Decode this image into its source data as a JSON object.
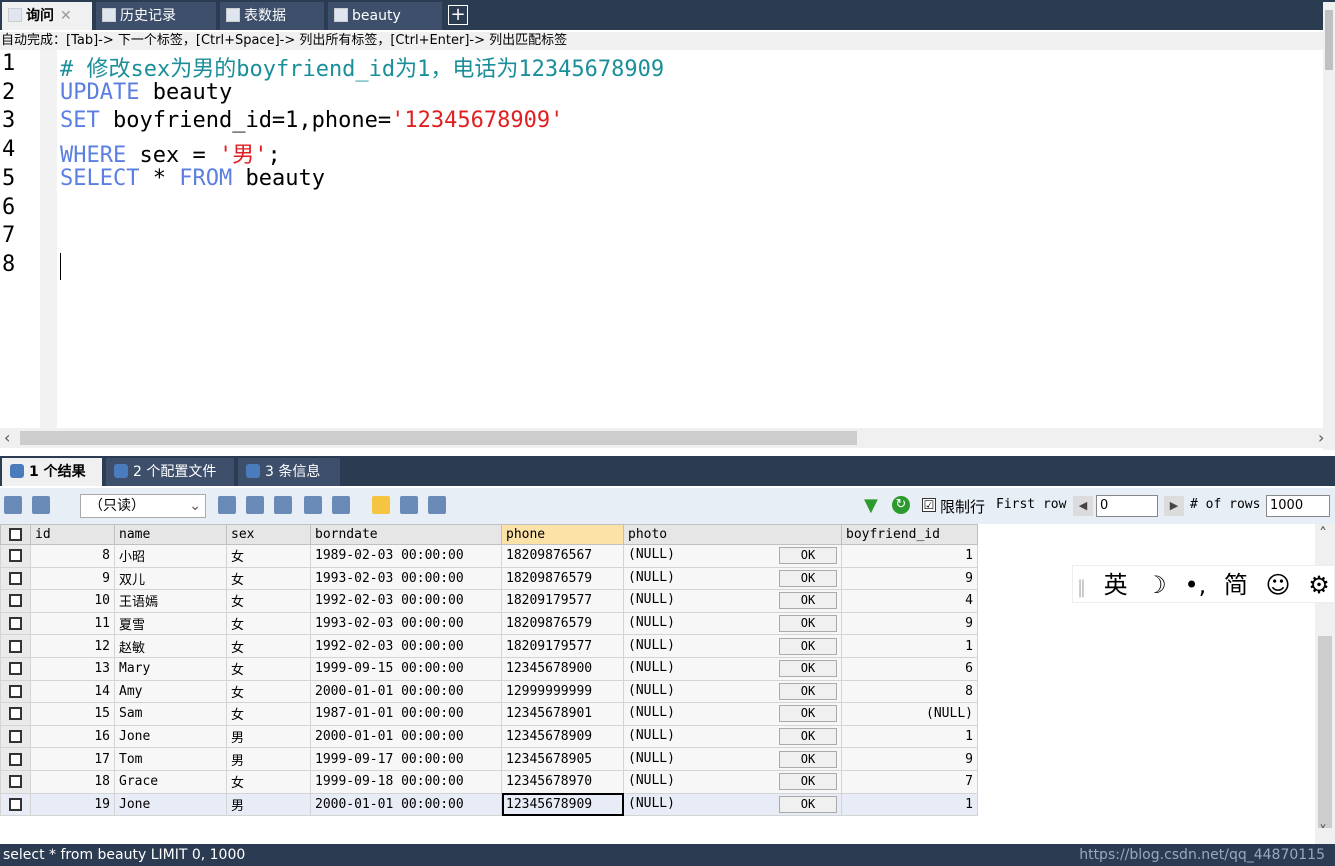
{
  "tabs": [
    {
      "label": "询问",
      "active": true,
      "icon": "query-icon",
      "closable": true
    },
    {
      "label": "历史记录",
      "active": false,
      "icon": "history-icon"
    },
    {
      "label": "表数据",
      "active": false,
      "icon": "table-data-icon"
    },
    {
      "label": "beauty",
      "active": false,
      "icon": "table-icon"
    }
  ],
  "tab_add_label": "+",
  "autocomplete_hint": "自动完成：[Tab]-> 下一个标签，[Ctrl+Space]-> 列出所有标签，[Ctrl+Enter]-> 列出匹配标签",
  "editor": {
    "line_numbers": [
      "1",
      "2",
      "3",
      "4",
      "5",
      "6",
      "7",
      "8"
    ],
    "lines": [
      [
        {
          "t": "# 修改sex为男的boyfriend_id为1，电话为12345678909",
          "c": "cm"
        }
      ],
      [
        {
          "t": "UPDATE",
          "c": "kw"
        },
        {
          "t": " beauty",
          "c": ""
        }
      ],
      [
        {
          "t": "SET",
          "c": "kw"
        },
        {
          "t": " boyfriend_id=1,phone=",
          "c": ""
        },
        {
          "t": "'12345678909'",
          "c": "str"
        }
      ],
      [
        {
          "t": "WHERE",
          "c": "kw"
        },
        {
          "t": " sex = ",
          "c": ""
        },
        {
          "t": "'男'",
          "c": "str"
        },
        {
          "t": ";",
          "c": ""
        }
      ],
      [
        {
          "t": "SELECT",
          "c": "kw"
        },
        {
          "t": " * ",
          "c": ""
        },
        {
          "t": "FROM",
          "c": "kw"
        },
        {
          "t": " beauty",
          "c": ""
        }
      ],
      [],
      [],
      []
    ]
  },
  "result_tabs": [
    {
      "label": "1 个结果",
      "active": true
    },
    {
      "label": "2 个配置文件",
      "active": false
    },
    {
      "label": "3 条信息",
      "active": false
    }
  ],
  "toolbar": {
    "readonly_label": "（只读）",
    "limit_label": "限制行",
    "limit_checked": "☑",
    "first_row_label": "First row",
    "first_row_value": "0",
    "rows_label": "# of rows",
    "rows_value": "1000"
  },
  "grid": {
    "columns": [
      "id",
      "name",
      "sex",
      "borndate",
      "phone",
      "photo",
      "boyfriend_id"
    ],
    "ok_label": "OK",
    "rows": [
      [
        "8",
        "小昭",
        "女",
        "1989-02-03 00:00:00",
        "18209876567",
        "(NULL)",
        "1"
      ],
      [
        "9",
        "双儿",
        "女",
        "1993-02-03 00:00:00",
        "18209876579",
        "(NULL)",
        "9"
      ],
      [
        "10",
        "王语嫣",
        "女",
        "1992-02-03 00:00:00",
        "18209179577",
        "(NULL)",
        "4"
      ],
      [
        "11",
        "夏雪",
        "女",
        "1993-02-03 00:00:00",
        "18209876579",
        "(NULL)",
        "9"
      ],
      [
        "12",
        "赵敏",
        "女",
        "1992-02-03 00:00:00",
        "18209179577",
        "(NULL)",
        "1"
      ],
      [
        "13",
        "Mary",
        "女",
        "1999-09-15 00:00:00",
        "12345678900",
        "(NULL)",
        "6"
      ],
      [
        "14",
        "Amy",
        "女",
        "2000-01-01 00:00:00",
        "12999999999",
        "(NULL)",
        "8"
      ],
      [
        "15",
        "Sam",
        "女",
        "1987-01-01 00:00:00",
        "12345678901",
        "(NULL)",
        "(NULL)"
      ],
      [
        "16",
        "Jone",
        "男",
        "2000-01-01 00:00:00",
        "12345678909",
        "(NULL)",
        "1"
      ],
      [
        "17",
        "Tom",
        "男",
        "1999-09-17 00:00:00",
        "12345678905",
        "(NULL)",
        "9"
      ],
      [
        "18",
        "Grace",
        "女",
        "1999-09-18 00:00:00",
        "12345678970",
        "(NULL)",
        "7"
      ],
      [
        "19",
        "Jone",
        "男",
        "2000-01-01 00:00:00",
        "12345678909",
        "(NULL)",
        "1"
      ]
    ]
  },
  "ime": [
    "英",
    "☽",
    "•,",
    "简",
    "☺",
    "⚙"
  ],
  "status_text": "select * from beauty LIMIT 0, 1000",
  "watermark": "https://blog.csdn.net/qq_44870115"
}
